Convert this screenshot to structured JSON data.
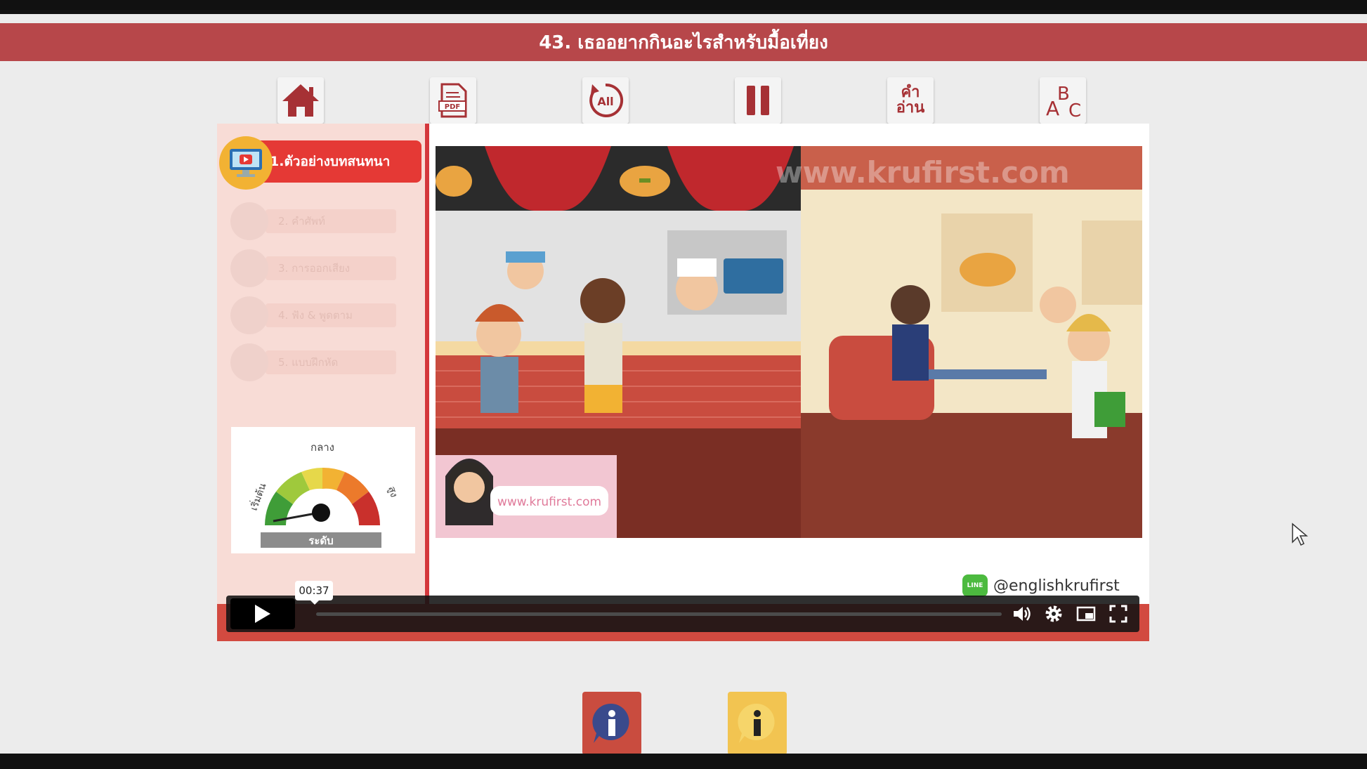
{
  "title": "43. เธออยากกินอะไรสำหรับมื้อเที่ยง",
  "toolbar": {
    "home_icon": "home-icon",
    "pdf_icon": "pdf-icon",
    "replay_all_icon": "replay-all-icon",
    "replay_all_label": "All",
    "pause_icon": "pause-icon",
    "reading_label_top": "คำ",
    "reading_label_bottom": "อ่าน",
    "abc_icon": "abc-icon"
  },
  "sidebar": {
    "active_item_label": "1.ตัวอย่างบทสนทนา",
    "items": [
      {
        "label": "2. คำศัพท์"
      },
      {
        "label": "3. การออกเสียง"
      },
      {
        "label": "4. ฟัง & พูดตาม"
      },
      {
        "label": "5. แบบฝึกหัด"
      }
    ]
  },
  "level_gauge": {
    "label_low": "เริ่มต้น",
    "label_mid": "กลาง",
    "label_high": "สูง",
    "caption": "ระดับ"
  },
  "video": {
    "watermark": "www.krufirst.com",
    "presenter_sign": "www.krufirst.com",
    "line_handle": "@englishkrufirst",
    "line_badge": "LINE",
    "time_tooltip": "00:37",
    "progress_fraction": 0.0
  },
  "colors": {
    "title_bar": "#b7474a",
    "accent_red": "#d4373c",
    "sidebar_bg": "#f8dcd6",
    "active_circle": "#f2b233"
  }
}
